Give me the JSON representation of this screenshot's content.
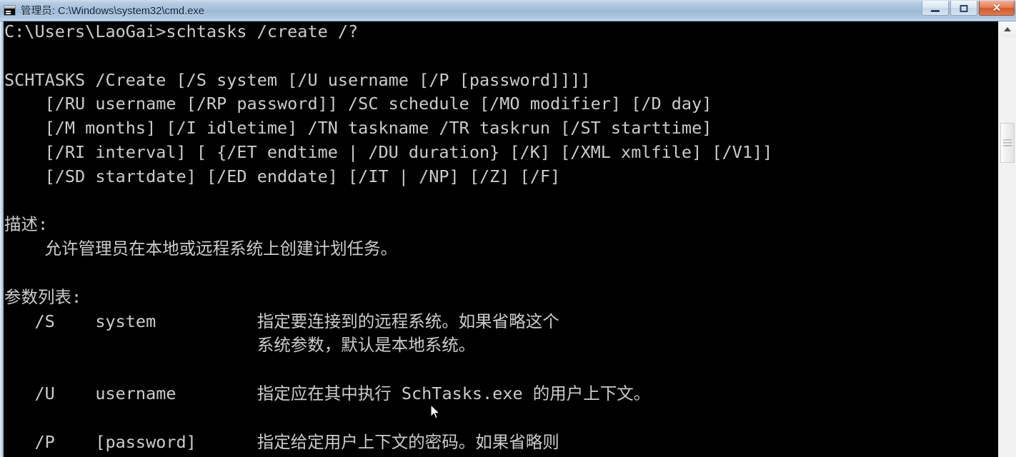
{
  "window": {
    "title": "管理员: C:\\Windows\\system32\\cmd.exe",
    "icon": "cmd-console-icon",
    "controls": {
      "minimize_label": "—",
      "maximize_label": "□",
      "close_label": "✕"
    }
  },
  "console": {
    "background_color": "#000000",
    "foreground_color": "#cccccc",
    "prompt_line": "C:\\Users\\LaoGai>schtasks /create /?",
    "command": "schtasks /create /?",
    "cwd": "C:\\Users\\LaoGai",
    "lines": [
      "C:\\Users\\LaoGai>schtasks /create /?",
      "",
      "SCHTASKS /Create [/S system [/U username [/P [password]]]]",
      "    [/RU username [/RP password]] /SC schedule [/MO modifier] [/D day]",
      "    [/M months] [/I idletime] /TN taskname /TR taskrun [/ST starttime]",
      "    [/RI interval] [ {/ET endtime | /DU duration} [/K] [/XML xmlfile] [/V1]]",
      "    [/SD startdate] [/ED enddate] [/IT | /NP] [/Z] [/F]",
      "",
      "描述:",
      "    允许管理员在本地或远程系统上创建计划任务。",
      "",
      "参数列表:",
      "   /S    system          指定要连接到的远程系统。如果省略这个",
      "                         系统参数，默认是本地系统。",
      "",
      "   /U    username        指定应在其中执行 SchTasks.exe 的用户上下文。",
      "",
      "   /P    [password]      指定给定用户上下文的密码。如果省略则"
    ],
    "sections": {
      "description_heading": "描述:",
      "description_body": "允许管理员在本地或远程系统上创建计划任务。",
      "params_heading": "参数列表:"
    },
    "parameters": [
      {
        "flag": "/S",
        "arg": "system",
        "description": "指定要连接到的远程系统。如果省略这个 系统参数，默认是本地系统。"
      },
      {
        "flag": "/U",
        "arg": "username",
        "description": "指定应在其中执行 SchTasks.exe 的用户上下文。"
      },
      {
        "flag": "/P",
        "arg": "[password]",
        "description": "指定给定用户上下文的密码。如果省略则"
      }
    ],
    "usage_syntax": [
      "SCHTASKS /Create [/S system [/U username [/P [password]]]]",
      "[/RU username [/RP password]] /SC schedule [/MO modifier] [/D day]",
      "[/M months] [/I idletime] /TN taskname /TR taskrun [/ST starttime]",
      "[/RI interval] [ {/ET endtime | /DU duration} [/K] [/XML xmlfile] [/V1]]",
      "[/SD startdate] [/ED enddate] [/IT | /NP] [/Z] [/F]"
    ]
  },
  "scrollbar": {
    "up_arrow": "scroll-up-arrow",
    "thumb_position_percent": 20
  },
  "colors": {
    "titlebar_gradient_top": "#cddcec",
    "titlebar_gradient_bottom": "#c9dcef",
    "title_text": "#0b2034",
    "close_button": "#d2582c",
    "console_bg": "#000000",
    "console_fg": "#cccccc",
    "scrollbar_bg": "#f0f0f0"
  }
}
